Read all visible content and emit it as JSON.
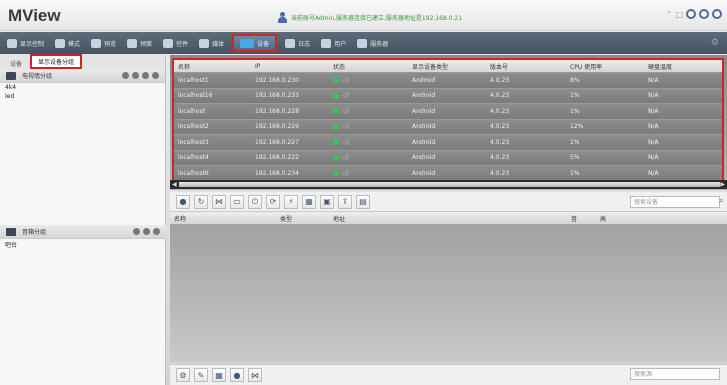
{
  "app": {
    "title": "MView",
    "status": "当前账号Admin,服务器连接已建立,服务器地址是192.168.0.21"
  },
  "toolbar": [
    {
      "label": "显示控制",
      "icon": "display-control-icon"
    },
    {
      "label": "模式",
      "icon": "mode-icon"
    },
    {
      "label": "预览",
      "icon": "preview-icon"
    },
    {
      "label": "预案",
      "icon": "plan-icon"
    },
    {
      "label": "控件",
      "icon": "widget-icon"
    },
    {
      "label": "媒体",
      "icon": "media-icon"
    },
    {
      "label": "设备",
      "icon": "device-icon",
      "active": true
    },
    {
      "label": "日志",
      "icon": "log-icon"
    },
    {
      "label": "用户",
      "icon": "user-icon"
    },
    {
      "label": "服务器",
      "icon": "server-icon"
    }
  ],
  "left_panel": {
    "tabs": [
      "设备",
      "显示设备分组"
    ],
    "display_group_header": "电视墙分组",
    "display_groups": [
      "4k4",
      "led"
    ],
    "speaker_group_header": "音箱分组",
    "speaker_groups": [
      "吧台"
    ]
  },
  "device_table": {
    "columns": [
      "名称",
      "IP",
      "状态",
      "显示设备类型",
      "版本号",
      "CPU 使用率",
      "硬盘温度"
    ],
    "rows": [
      [
        "localhost1",
        "192.168.0.230",
        "",
        "Android",
        "4.0.23",
        "8%",
        "N/A"
      ],
      [
        "localhost16",
        "192.168.0.233",
        "",
        "Android",
        "4.0.23",
        "1%",
        "N/A"
      ],
      [
        "localhost",
        "192.168.0.228",
        "",
        "Android",
        "4.0.23",
        "1%",
        "N/A"
      ],
      [
        "localhost2",
        "192.168.0.229",
        "",
        "Android",
        "4.0.23",
        "12%",
        "N/A"
      ],
      [
        "localhost3",
        "192.168.0.227",
        "",
        "Android",
        "4.0.23",
        "1%",
        "N/A"
      ],
      [
        "localhost4",
        "192.168.0.222",
        "",
        "Android",
        "4.0.23",
        "5%",
        "N/A"
      ],
      [
        "localhost6",
        "192.168.0.234",
        "",
        "Android",
        "4.0.23",
        "1%",
        "N/A"
      ]
    ]
  },
  "search": {
    "device_placeholder": "搜索设备",
    "speaker_placeholder": "搜索源"
  },
  "speaker_table": {
    "columns": [
      "名称",
      "类型",
      "地址",
      "音",
      "高"
    ]
  }
}
